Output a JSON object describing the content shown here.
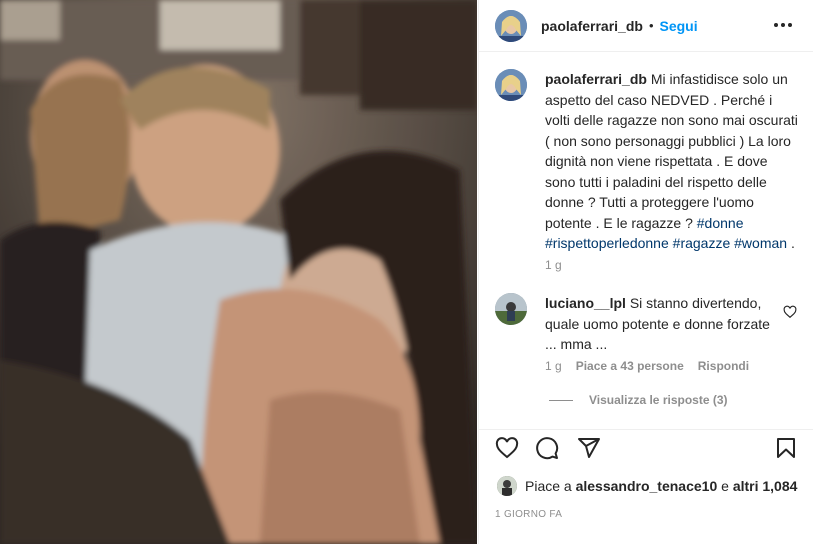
{
  "post": {
    "author": "paolaferrari_db",
    "dot": "•",
    "follow_label": "Segui"
  },
  "caption": {
    "username": "paolaferrari_db",
    "text": "Mi infastidisce solo un aspetto del caso NEDVED . Perché i volti delle ragazze non sono mai oscurati ( non sono personaggi pubblici ) La loro dignità non viene rispettata . E dove sono tutti i paladini del rispetto delle donne ? Tutti a proteggere l'uomo potente . E le ragazze ?",
    "hashtags": [
      "#donne",
      "#rispettoperledonne",
      "#ragazze",
      "#woman"
    ],
    "trailing": ".",
    "time": "1 g"
  },
  "comment": {
    "username": "luciano__lpl",
    "text": "Si stanno divertendo, quale uomo potente e donne forzate ... mma ...",
    "time": "1 g",
    "likes": "Piace a 43 persone",
    "reply_label": "Rispondi",
    "view_replies": "Visualizza le risposte (3)"
  },
  "likes": {
    "prefix": "Piace a",
    "user": "alessandro_tenace10",
    "conj": "e",
    "others": "altri 1,084"
  },
  "posted_ago": "1 GIORNO FA",
  "icons": {
    "like": "heart-icon",
    "comment": "comment-icon",
    "share": "share-icon",
    "save": "bookmark-icon",
    "more": "more-icon",
    "comment_like": "heart-icon"
  },
  "colors": {
    "link": "#0095f6",
    "hashtag": "#00376b",
    "muted": "#8e8e8e"
  }
}
